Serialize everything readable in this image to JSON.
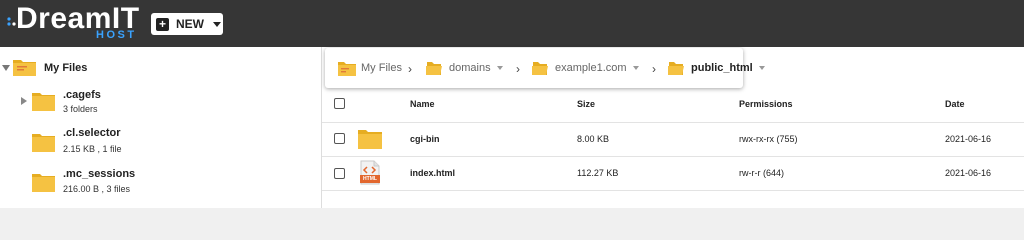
{
  "brand": {
    "wordmark": "DreamIT",
    "sub": "HOST",
    "accent": "#3aa3ff"
  },
  "toolbar": {
    "new_label": "NEW"
  },
  "sidebar": {
    "root": {
      "label": "My Files"
    },
    "items": [
      {
        "name": ".cagefs",
        "meta": "3 folders",
        "expandable": true
      },
      {
        "name": ".cl.selector",
        "meta": "2.15 KB , 1 file",
        "expandable": false
      },
      {
        "name": ".mc_sessions",
        "meta": "216.00 B , 3 files",
        "expandable": false
      }
    ]
  },
  "breadcrumb": {
    "items": [
      "My Files",
      "domains",
      "example1.com",
      "public_html"
    ],
    "separator": "›"
  },
  "table": {
    "columns": [
      "Name",
      "Size",
      "Permissions",
      "Date"
    ],
    "rows": [
      {
        "type_icon": "folder-icon",
        "name": "cgi-bin",
        "size": "8.00 KB",
        "permissions": "rwx-rx-rx (755)",
        "date": "2021-06-16"
      },
      {
        "type_icon": "html-file-icon",
        "icon_text": "HTML",
        "name": "index.html",
        "size": "112.27 KB",
        "permissions": "rw-r-r (644)",
        "date": "2021-06-16"
      }
    ]
  },
  "colors": {
    "topbar": "#363636",
    "folder": "#f5c242",
    "folder_dark": "#e6ad22"
  }
}
